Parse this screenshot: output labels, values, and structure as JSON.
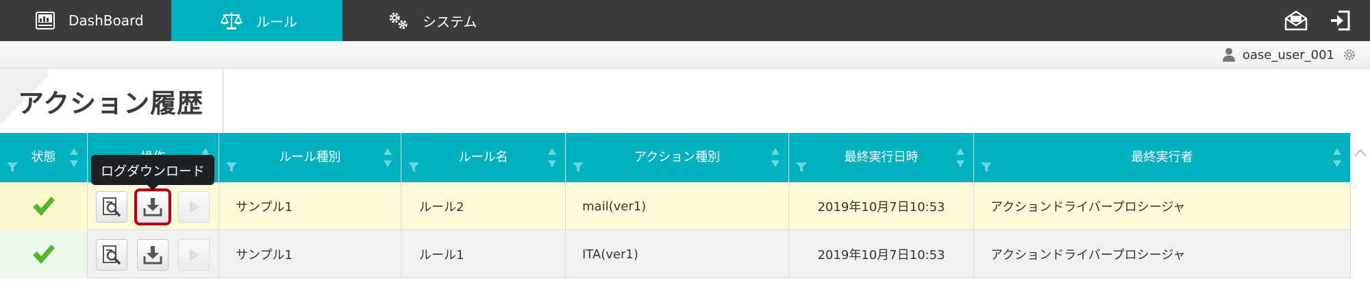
{
  "nav": {
    "tabs": [
      {
        "label": "DashBoard",
        "icon": "dashboard-icon"
      },
      {
        "label": "ルール",
        "icon": "scales-icon",
        "active": true
      },
      {
        "label": "システム",
        "icon": "gears-icon"
      }
    ],
    "right_icons": [
      "mail-icon",
      "logout-icon"
    ]
  },
  "user": {
    "name": "oase_user_001"
  },
  "page": {
    "title": "アクション履歴"
  },
  "table": {
    "columns": [
      "状態",
      "操作",
      "ルール種別",
      "ルール名",
      "アクション種別",
      "最終実行日時",
      "最終実行者"
    ],
    "rows": [
      {
        "status": "success",
        "rule_type": "サンプル1",
        "rule_name": "ルール2",
        "action_type": "mail(ver1)",
        "last_exec_date": "2019年10月7日10:53",
        "last_exec_user": "アクションドライバープロシージャ"
      },
      {
        "status": "success",
        "rule_type": "サンプル1",
        "rule_name": "ルール1",
        "action_type": "ITA(ver1)",
        "last_exec_date": "2019年10月7日10:53",
        "last_exec_user": "アクションドライバープロシージャ"
      }
    ]
  },
  "tooltip": {
    "text": "ログダウンロード"
  },
  "colors": {
    "accent": "#00b1bf",
    "nav_bg": "#3c3c3c",
    "check": "#4cb82a",
    "focus": "#b3001b"
  }
}
